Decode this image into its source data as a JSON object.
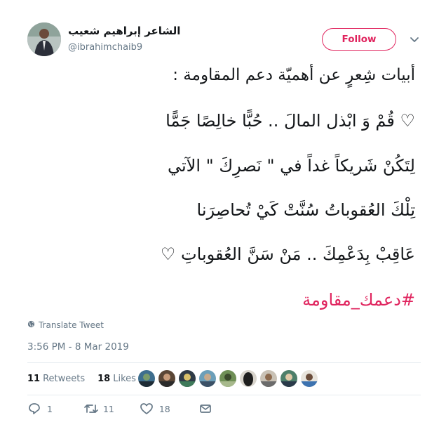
{
  "user": {
    "display_name": "الشاعر إبراهيم شعيب",
    "handle": "@ibrahimchaib9"
  },
  "follow_label": "Follow",
  "tweet": {
    "lines": [
      "أبيات شِعرٍ عن أهميّة دعم المقاومة :",
      "♡ قُمْ وَ ابْذل المالَ .. حُبًّا خالِصًا جَمًّا",
      "لِتَكُنْ شَريكاً غداً في \" نَصرِكَ \" الآتي",
      "تِلْكَ العُقوباتُ سُنَّتْ كَيْ تُحاصِرَنا",
      "عَاقِبْ بِدَعْمِكَ .. مَنْ سَنَّ العُقوباتِ ♡"
    ],
    "hashtag": "#دعمك_مقاومة"
  },
  "translate_label": "Translate Tweet",
  "timestamp": "3:56 PM - 8 Mar 2019",
  "stats": {
    "retweets_count": "11",
    "retweets_label": "Retweets",
    "likes_count": "18",
    "likes_label": "Likes"
  },
  "actions": {
    "reply_count": "1",
    "retweet_count": "11",
    "like_count": "18"
  },
  "colors": {
    "accent": "#e0245e",
    "secondary_text": "#657786",
    "divider": "#e6ecf0"
  },
  "icons": [
    "globe-icon",
    "chevron-down-icon",
    "reply-icon",
    "retweet-icon",
    "heart-icon",
    "message-icon"
  ]
}
